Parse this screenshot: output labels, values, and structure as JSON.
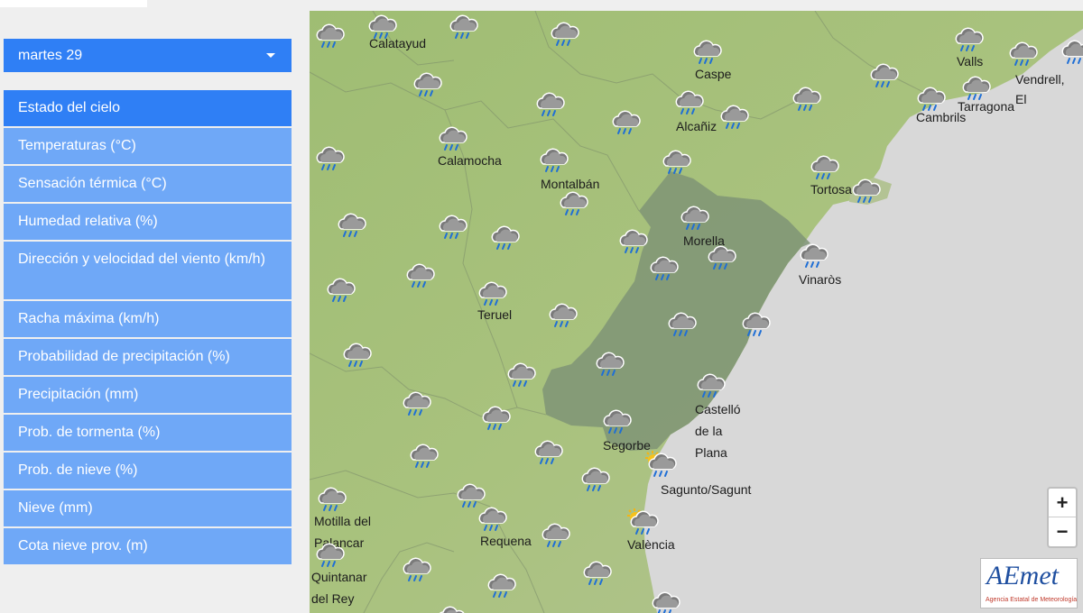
{
  "panel": {
    "date_label": "martes 29",
    "menu": [
      "Estado del cielo",
      "Temperaturas (°C)",
      "Sensación térmica (°C)",
      "Humedad relativa (%)",
      "Dirección y velocidad del viento (km/h)",
      "Racha máxima (km/h)",
      "Probabilidad de precipitación (%)",
      "Precipitación (mm)",
      "Prob. de tormenta (%)",
      "Prob. de nieve (%)",
      "Nieve (mm)",
      "Cota nieve prov. (m)"
    ]
  },
  "map": {
    "places": {
      "calatayud": "Calatayud",
      "caspe": "Caspe",
      "valls": "Valls",
      "vendrell": "Vendrell,",
      "el": "El",
      "tarragona": "Tarragona",
      "cambrils": "Cambrils",
      "alcaniz": "Alcañiz",
      "calamocha": "Calamocha",
      "montalban": "Montalbán",
      "tortosa": "Tortosa",
      "morella": "Morella",
      "vinaros": "Vinaròs",
      "teruel": "Teruel",
      "castello_1": "Castelló",
      "castello_2": "de la",
      "castello_3": "Plana",
      "segorbe": "Segorbe",
      "sagunto": "Sagunto/Sagunt",
      "motilla_1": "Motilla del",
      "motilla_2": "Palancar",
      "requena": "Requena",
      "valencia": "València",
      "quintanar_1": "Quintanar",
      "quintanar_2": "del Rey"
    },
    "symbol_legend": {
      "rain": "cloud-rain-icon",
      "sun_rain": "sun-cloud-rain-icon"
    },
    "colors": {
      "sea": "#d8d8d8",
      "land": "#a9c27e",
      "highlight_region": "#7f9475",
      "panel_active": "#2f7ff5",
      "panel_item": "#6fa8f7"
    },
    "zoom_in": "+",
    "zoom_out": "−",
    "logo_text": "AEmet",
    "logo_sub": "Agencia Estatal de Meteorología"
  }
}
